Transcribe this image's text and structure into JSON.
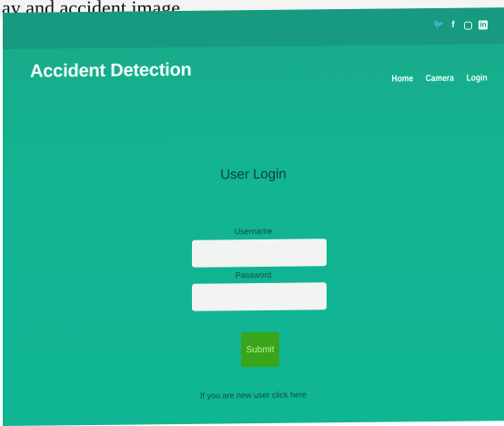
{
  "caption": "ay and accident image",
  "header": {
    "brand": "Accident Detection",
    "nav": [
      {
        "label": "Home"
      },
      {
        "label": "Camera"
      },
      {
        "label": "Login"
      }
    ],
    "social": [
      "twitter-icon",
      "facebook-icon",
      "instagram-icon",
      "linkedin-icon"
    ]
  },
  "login": {
    "title": "User Login",
    "username_label": "Username",
    "password_label": "Password",
    "username_value": "",
    "password_value": "",
    "submit_label": "Submit",
    "new_user_text": "If you are new user",
    "new_user_link": "click here"
  },
  "colors": {
    "background": "#12b491",
    "topbar": "#179a7f",
    "submit": "#3aa51b"
  }
}
